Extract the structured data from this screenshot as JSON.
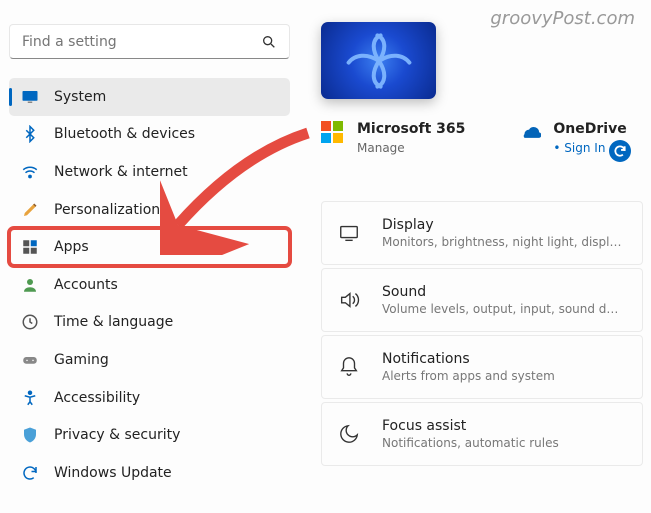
{
  "watermark": "groovyPost.com",
  "search": {
    "placeholder": "Find a setting"
  },
  "nav": {
    "items": [
      {
        "label": "System"
      },
      {
        "label": "Bluetooth & devices"
      },
      {
        "label": "Network & internet"
      },
      {
        "label": "Personalization"
      },
      {
        "label": "Apps"
      },
      {
        "label": "Accounts"
      },
      {
        "label": "Time & language"
      },
      {
        "label": "Gaming"
      },
      {
        "label": "Accessibility"
      },
      {
        "label": "Privacy & security"
      },
      {
        "label": "Windows Update"
      }
    ]
  },
  "accounts": {
    "m365": {
      "title": "Microsoft 365",
      "sub": "Manage"
    },
    "onedrive": {
      "title": "OneDrive",
      "sub": "Sign In"
    }
  },
  "cards": [
    {
      "title": "Display",
      "sub": "Monitors, brightness, night light, display profile"
    },
    {
      "title": "Sound",
      "sub": "Volume levels, output, input, sound devices"
    },
    {
      "title": "Notifications",
      "sub": "Alerts from apps and system"
    },
    {
      "title": "Focus assist",
      "sub": "Notifications, automatic rules"
    }
  ]
}
